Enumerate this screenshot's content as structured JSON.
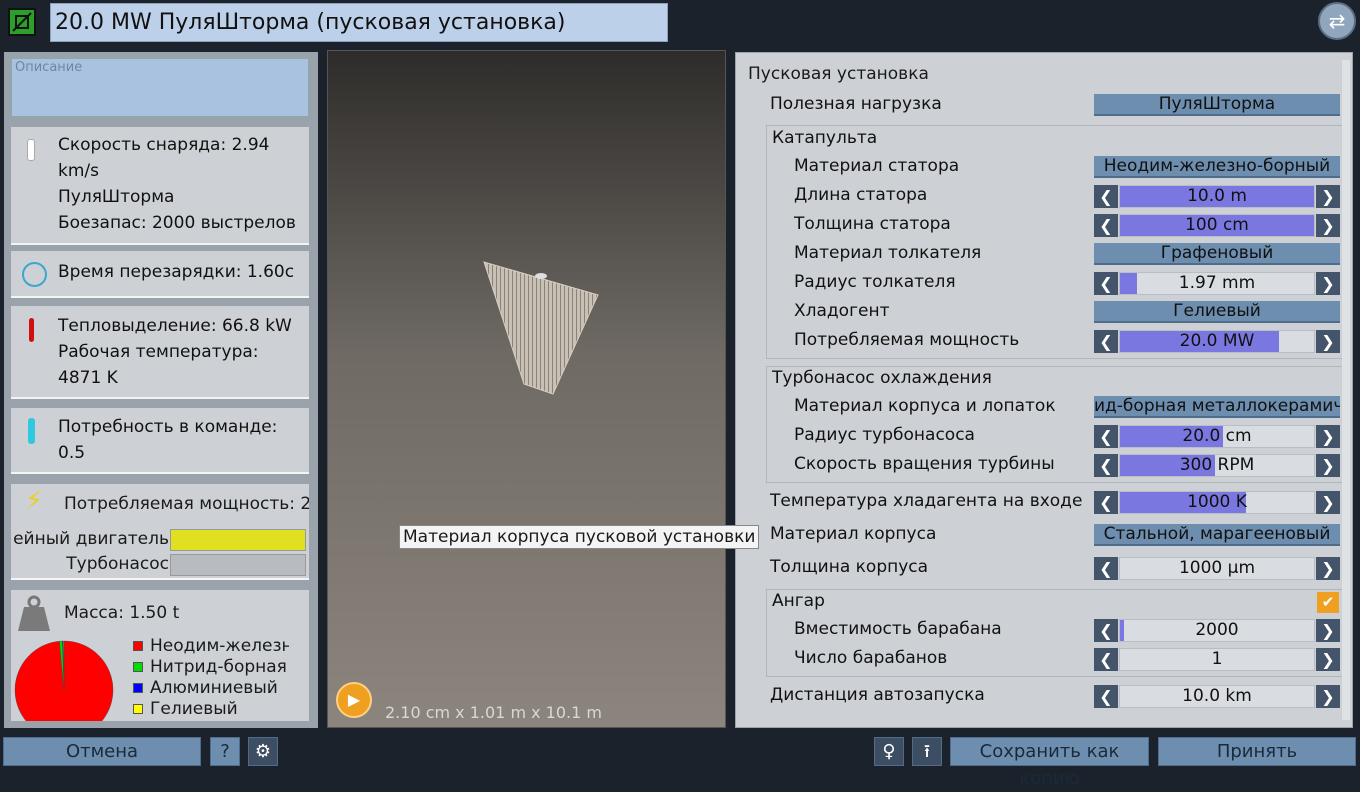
{
  "header": {
    "title": "20.0 MW ПуляШторма (пусковая установка)"
  },
  "left": {
    "description_placeholder": "Описание",
    "stats": [
      "Скорость снаряда: 2.94",
      "km/s",
      "ПуляШторма",
      "Боезапас: 2000 выстрелов"
    ],
    "reload": "Время перезарядки: 1.60с",
    "heat": [
      "Тепловыделение: 66.8 kW",
      "Рабочая температура:",
      "4871 K"
    ],
    "crew": [
      "Потребность в команде:",
      "0.5"
    ],
    "power": {
      "title": "Потребляемая мощность: 2",
      "bars": [
        {
          "label": "ейный двигатель",
          "fraction": 1.0,
          "color": "#e0e020"
        },
        {
          "label": "Турбонасос",
          "fraction": 0.0,
          "color": "#e0e020"
        }
      ]
    },
    "mass": {
      "title": "Масса: 1.50 t",
      "legend": [
        {
          "label": "Неодим-железно-борный",
          "color": "#ff0000"
        },
        {
          "label": "Нитрид-борная металлокерамика",
          "color": "#00dd00"
        },
        {
          "label": "Алюминиевый",
          "color": "#0000ff"
        },
        {
          "label": "Гелиевый",
          "color": "#ffff00"
        }
      ],
      "pie_fractions": [
        0.985,
        0.01,
        0.003,
        0.002
      ]
    }
  },
  "viewport": {
    "dimensions": "2.10 cm x 1.01 m x 10.1 m",
    "tooltip": "Материал корпуса пусковой установки"
  },
  "right": {
    "section_title": "Пусковая установка",
    "rows": [
      {
        "label": "Полезная нагрузка",
        "type": "combo",
        "value": "ПуляШторма",
        "indent": 1
      },
      {
        "label": "Катапульта",
        "type": "header",
        "indent": 1
      },
      {
        "label": "Материал статора",
        "type": "combo",
        "value": "Неодим-железно-борный",
        "indent": 2
      },
      {
        "label": "Длина статора",
        "type": "slider",
        "value": "10.0 m",
        "fraction": 1.0,
        "indent": 2
      },
      {
        "label": "Толщина статора",
        "type": "slider",
        "value": "100 cm",
        "fraction": 1.0,
        "indent": 2
      },
      {
        "label": "Материал толкателя",
        "type": "combo",
        "value": "Графеновый",
        "indent": 2
      },
      {
        "label": "Радиус толкателя",
        "type": "slider",
        "value": "1.97 mm",
        "fraction": 0.09,
        "indent": 2
      },
      {
        "label": "Хладогент",
        "type": "combo",
        "value": "Гелиевый",
        "indent": 2
      },
      {
        "label": "Потребляемая мощность",
        "type": "slider",
        "value": "20.0 MW",
        "fraction": 0.82,
        "indent": 2
      },
      {
        "label": "Турбонасос охлаждения",
        "type": "header",
        "indent": 1
      },
      {
        "label": "Материал корпуса и лопаток",
        "type": "combo",
        "value": "ид-борная металлокерамич",
        "indent": 2
      },
      {
        "label": "Радиус турбонасоса",
        "type": "slider",
        "value": "20.0 cm",
        "fraction": 0.53,
        "indent": 2
      },
      {
        "label": "Скорость вращения турбины",
        "type": "slider",
        "value": "300 RPM",
        "fraction": 0.49,
        "indent": 2
      },
      {
        "label": "Температура хладагента на входе",
        "type": "slider",
        "value": "1000 K",
        "fraction": 0.65,
        "indent": 1
      },
      {
        "label": "Материал корпуса",
        "type": "combo",
        "value": "Стальной, марагееновый",
        "indent": 1
      },
      {
        "label": "Толщина корпуса",
        "type": "slider",
        "value": "1000 µm",
        "fraction": 0.0,
        "indent": 1
      },
      {
        "label": "Ангар",
        "type": "check",
        "checked": true,
        "indent": 1
      },
      {
        "label": "Вместимость барабана",
        "type": "slider",
        "value": "2000",
        "fraction": 0.02,
        "indent": 2
      },
      {
        "label": "Число барабанов",
        "type": "slider",
        "value": "1",
        "fraction": 0.0,
        "indent": 2
      },
      {
        "label": "Дистанция автозапуска",
        "type": "slider",
        "value": "10.0 km",
        "fraction": 0.0,
        "indent": 1
      }
    ]
  },
  "footer": {
    "cancel": "Отмена",
    "help": "?",
    "save_copy": "Сохранить как копию",
    "accept": "Принять"
  }
}
